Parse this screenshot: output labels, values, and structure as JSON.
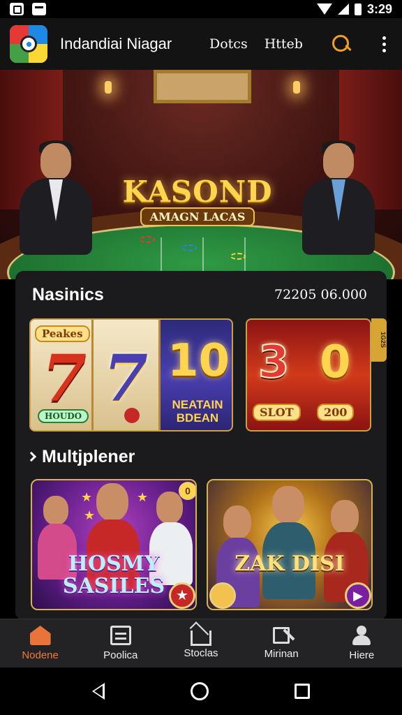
{
  "status_bar": {
    "time": "3:29",
    "icons": [
      "notification-icon",
      "image-icon",
      "wifi-icon",
      "signal-icon",
      "battery-icon"
    ]
  },
  "app_bar": {
    "title": "Indandiai Niagar",
    "links": [
      "Dotcs",
      "Htteb"
    ],
    "icons": [
      "search-icon",
      "more-vert-icon"
    ],
    "accent": "#f0a020"
  },
  "hero": {
    "logo_text": "KASOND",
    "logo_subtext": "AMAGN LACAS"
  },
  "section_slots": {
    "title": "Nasinics",
    "meta": "72205 06.000",
    "slot1": {
      "badge": "Peakes",
      "reel1": "7",
      "reel2": "7",
      "reel1_sub": "HOUDO",
      "reel3_number": "10",
      "reel3_label": "NEATAIN BDEAN"
    },
    "slot2": {
      "num1": "3",
      "num2": "0",
      "badge_left": "SLOT",
      "badge_right": "200"
    },
    "side_tag": "1G2S"
  },
  "section_multiplayer": {
    "title": "Multjplener",
    "games": [
      {
        "title": "HOSMY SASILES",
        "corner_badge": "0",
        "action_icon": "star-icon"
      },
      {
        "title": "ZAK DISI",
        "action_icon": "play-icon"
      }
    ]
  },
  "bottom_nav": {
    "items": [
      {
        "label": "Nodene",
        "icon": "home-icon",
        "active": true
      },
      {
        "label": "Poolica",
        "icon": "box-icon",
        "active": false
      },
      {
        "label": "Stoclas",
        "icon": "house-icon",
        "active": false
      },
      {
        "label": "Mirinan",
        "icon": "edit-icon",
        "active": false
      },
      {
        "label": "Hiere",
        "icon": "user-icon",
        "active": false
      }
    ],
    "active_color": "#f07a3a"
  },
  "system_nav": {
    "icons": [
      "back-icon",
      "home-circle-icon",
      "recents-icon"
    ]
  }
}
